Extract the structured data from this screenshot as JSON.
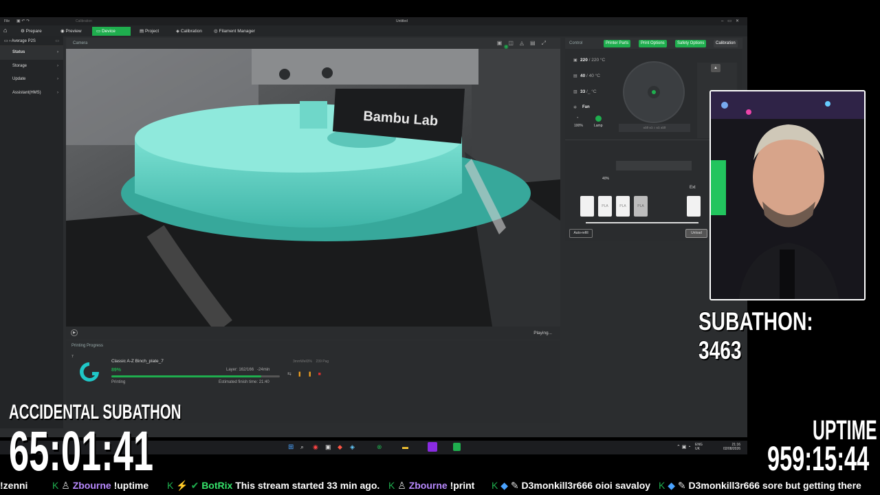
{
  "window": {
    "title": "Untitled",
    "menu": "File",
    "calib_hint": "Calibration"
  },
  "tabs": [
    {
      "label": "Prepare"
    },
    {
      "label": "Preview"
    },
    {
      "label": "Device"
    },
    {
      "label": "Project"
    },
    {
      "label": "Calibration"
    },
    {
      "label": "Filament Manager"
    }
  ],
  "sidebar": {
    "device": "Average P2S",
    "items": [
      {
        "label": "Status"
      },
      {
        "label": "Storage"
      },
      {
        "label": "Update"
      },
      {
        "label": "Assistant(HMS)"
      }
    ]
  },
  "camera": {
    "header": "Camera",
    "status": "Playing...",
    "toolhead_brand": "Bambu Lab"
  },
  "progress": {
    "header": "Printing Progress",
    "plate_num": "7",
    "job_name": "Classic A-Z Binch_plate_7",
    "percent_text": "89%",
    "percent_value": 0.89,
    "layer": "Layer: 162/166",
    "remaining": "-24min",
    "state": "Printing",
    "eta": "Estimated finish time: 21:40",
    "meta1": "3mmWell3%",
    "meta2": "239 Pag"
  },
  "control": {
    "header": "Control",
    "buttons": {
      "printer_parts": "Printer Parts",
      "print_options": "Print Options",
      "safety_options": "Safety Options",
      "calibration": "Calibration"
    },
    "nozzle_temp": "220",
    "nozzle_target": "/ 220 °C",
    "bed_temp": "40",
    "bed_target": "/ 40 °C",
    "chamber_temp": "33",
    "chamber_unit": "/_ °C",
    "fan_label": "Fan",
    "fan_value": "100%",
    "lamp_label": "Lamp",
    "ams_humidity": "40%",
    "ext_label": "Ext",
    "slot_labels": [
      "PLA",
      "PLA",
      "PLA"
    ],
    "auto_refill": "Auto-refill",
    "unload": "Unload",
    "accent": "#1fae4e"
  },
  "taskbar": {
    "lang1": "ENG",
    "lang2": "UK",
    "time": "21:16",
    "date": "02/08/2026"
  },
  "overlay": {
    "subathon_count": "SUBATHON: 3463",
    "accidental_title": "ACCIDENTAL SUBATHON",
    "accidental_timer": "65:01:41",
    "uptime_label": "UPTIME",
    "uptime_timer": "959:15:44"
  },
  "ticker": [
    {
      "user": "",
      "msg": "!zenni"
    },
    {
      "user": "Zbourne",
      "msg": "!uptime"
    },
    {
      "user": "BotRix",
      "msg": "This stream started 33 min ago."
    },
    {
      "user": "Zbourne",
      "msg": "!print"
    },
    {
      "user": "D3monkill3r666",
      "msg": "oioi savaloy"
    },
    {
      "user": "D3monkill3r666",
      "msg": "sore but getting there"
    }
  ]
}
